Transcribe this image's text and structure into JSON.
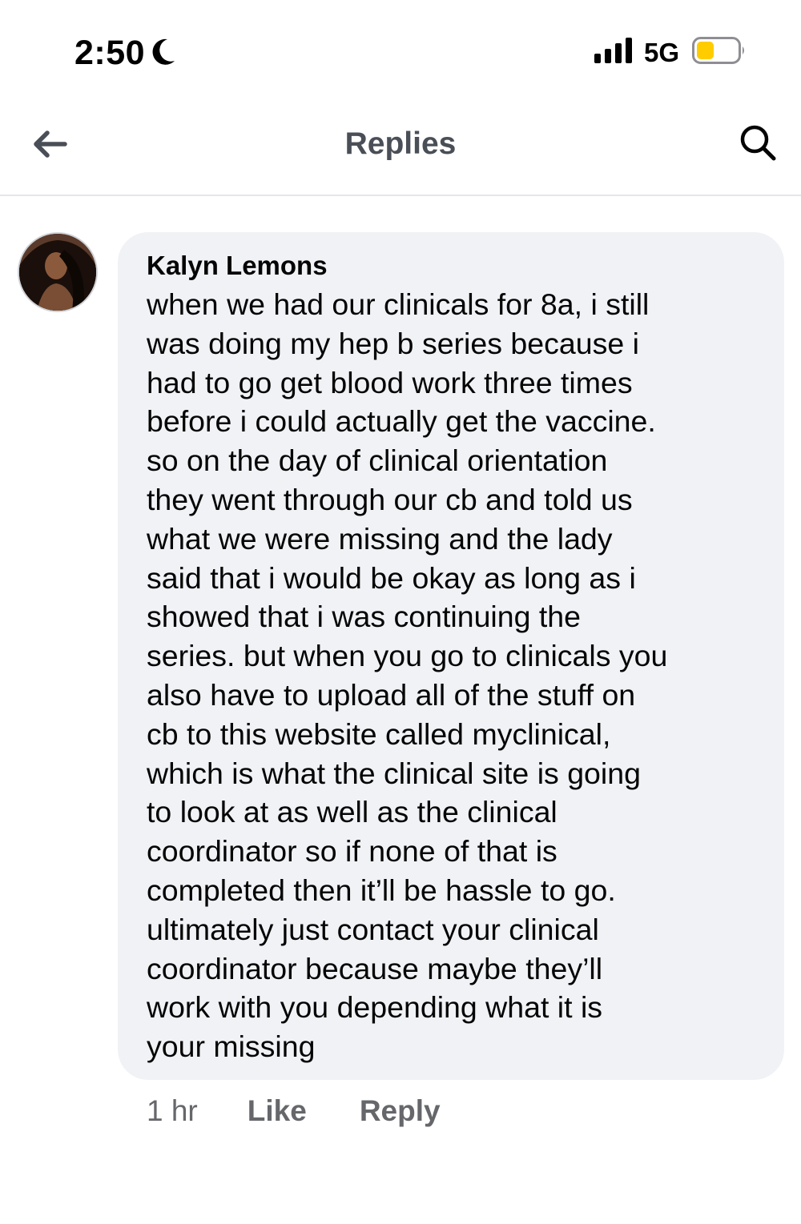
{
  "status_bar": {
    "time": "2:50",
    "moon_icon": "moon-icon",
    "signal_icon": "signal-bars-icon",
    "network": "5G",
    "battery_icon": "battery-icon",
    "battery_color": "#ffcc00"
  },
  "nav": {
    "back_icon": "arrow-left-icon",
    "title": "Replies",
    "search_icon": "search-icon"
  },
  "comment": {
    "avatar_icon": "avatar",
    "author": "Kalyn Lemons",
    "lines": [
      "when we had our clinicals for 8a, i still",
      "was doing my hep b series because i",
      "had to go get blood work three times",
      "before i could actually get the vaccine.",
      "so on the day of clinical orientation",
      "they went through our cb and told us",
      "what we were missing and the lady",
      "said that i would be okay as long as i",
      "showed that i was continuing the",
      "series. but when you go to clinicals you",
      "also have to upload all of the stuff on",
      "cb to this website called myclinical,",
      "which is what the clinical site is going",
      "to look at as well as the clinical",
      "coordinator so if none of that is",
      "completed then it’ll be hassle to go.",
      "ultimately just contact your clinical",
      "coordinator because maybe they’ll",
      "work with you depending what it is",
      "your missing"
    ],
    "timestamp": "1 hr",
    "like_label": "Like",
    "reply_label": "Reply"
  },
  "colors": {
    "bubble": "#f0f2f5",
    "secondary_text": "#65676b",
    "title_text": "#4a4e57"
  }
}
